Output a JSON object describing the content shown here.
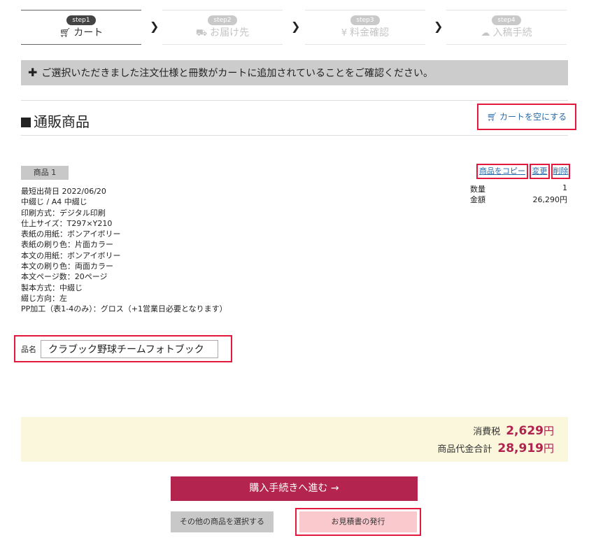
{
  "steps": [
    {
      "pill": "step1",
      "title": "カート",
      "icon": "cart-icon"
    },
    {
      "pill": "step2",
      "title": "お届け先",
      "icon": "truck-icon"
    },
    {
      "pill": "step3",
      "title": "料金確認",
      "icon": "yen-icon"
    },
    {
      "pill": "step4",
      "title": "入稿手続",
      "icon": "cloud-upload-icon"
    }
  ],
  "notice": {
    "icon": "plus-icon",
    "text": "ご選択いただきました注文仕様と冊数がカートに追加されていることをご確認ください。"
  },
  "section": {
    "title": "通販商品",
    "empty_cart_label": "カートを空にする"
  },
  "item": {
    "badge": "商品 1",
    "specs": [
      "最短出荷日 2022/06/20",
      "中綴じ / A4 中綴じ",
      "印刷方式：デジタル印刷",
      "仕上サイズ：T297×Y210",
      "表紙の用紙：ボンアイボリー",
      "表紙の刷り色：片面カラー",
      "本文の用紙：ボンアイボリー",
      "本文の刷り色：両面カラー",
      "本文ページ数：20ページ",
      "製本方式：中綴じ",
      "綴じ方向：左",
      "PP加工（表1-4のみ）：グロス（+1営業日必要となります）"
    ],
    "actions": {
      "copy": "商品をコピー",
      "change": "変更",
      "delete": "削除"
    },
    "quantity_label": "数量",
    "quantity_value": "1",
    "amount_label": "金額",
    "amount_value": "26,290円",
    "name_label": "品名",
    "name_value": "クラブック野球チームフォトブック"
  },
  "totals": {
    "tax_label": "消費税",
    "tax_value": "2,629",
    "total_label": "商品代金合計",
    "total_value": "28,919",
    "unit": "円"
  },
  "buttons": {
    "proceed": "購入手続きへ進む →",
    "other": "その他の商品を選択する",
    "estimate": "お見積書の発行"
  }
}
